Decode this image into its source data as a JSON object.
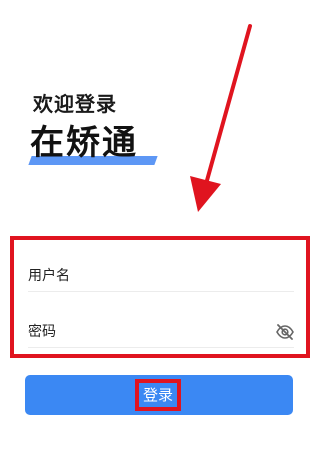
{
  "header": {
    "welcome_text": "欢迎登录",
    "brand_name": "在矫通"
  },
  "form": {
    "username_placeholder": "用户名",
    "password_placeholder": "密码"
  },
  "login_button": {
    "label": "登录"
  },
  "icons": {
    "password_toggle": "eye-off-icon"
  },
  "colors": {
    "primary_button": "#3b88f3",
    "brand_accent": "#5d97f5",
    "annotation_red": "#e0141f"
  }
}
